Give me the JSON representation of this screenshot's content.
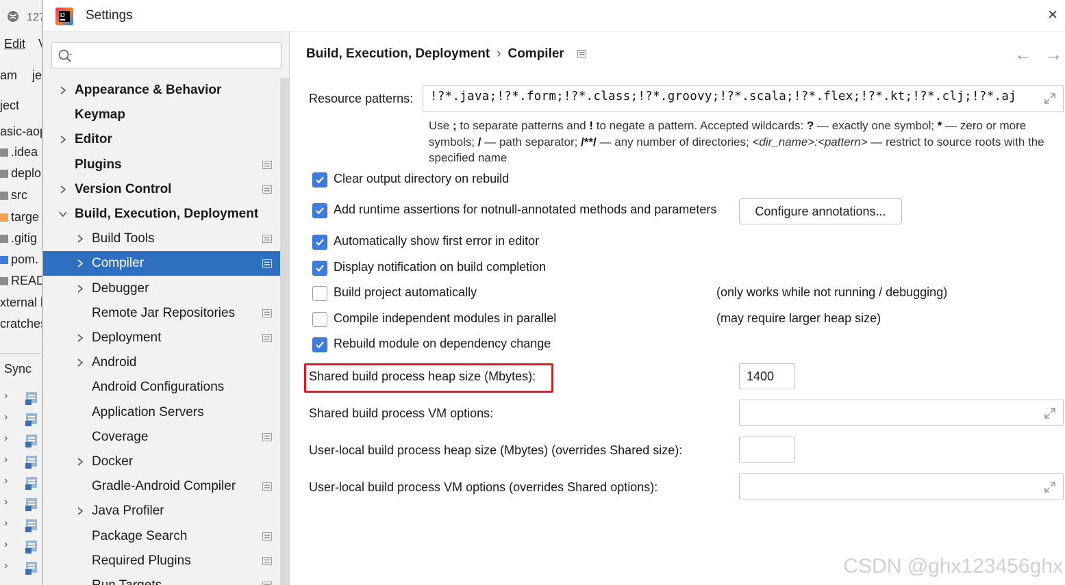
{
  "background_ide": {
    "tab_text": "127",
    "menu_edit": "Edit",
    "menu_next": "V",
    "breadcrumb_a": "am",
    "breadcrumb_b": "je",
    "project_label": "ject",
    "tree_root": "asic-aop",
    "tree_items": [
      ".idea",
      "deplo",
      "src",
      "targe",
      ".gitig",
      "pom.",
      "READ"
    ],
    "external": "xternal l",
    "scratches": "cratches",
    "sync": "Sync"
  },
  "dialog": {
    "title": "Settings",
    "close_symbol": "×"
  },
  "search": {
    "value": "",
    "placeholder": ""
  },
  "nav": {
    "items": [
      {
        "label": "Appearance & Behavior",
        "level": 0,
        "bold": true,
        "chevron": "right",
        "project_icon": false,
        "selected": false
      },
      {
        "label": "Keymap",
        "level": 0,
        "bold": true,
        "chevron": "none",
        "project_icon": false,
        "selected": false
      },
      {
        "label": "Editor",
        "level": 0,
        "bold": true,
        "chevron": "right",
        "project_icon": false,
        "selected": false
      },
      {
        "label": "Plugins",
        "level": 0,
        "bold": true,
        "chevron": "none",
        "project_icon": true,
        "selected": false
      },
      {
        "label": "Version Control",
        "level": 0,
        "bold": true,
        "chevron": "right",
        "project_icon": true,
        "selected": false
      },
      {
        "label": "Build, Execution, Deployment",
        "level": 0,
        "bold": true,
        "chevron": "down",
        "project_icon": false,
        "selected": false
      },
      {
        "label": "Build Tools",
        "level": 1,
        "bold": false,
        "chevron": "right",
        "project_icon": true,
        "selected": false
      },
      {
        "label": "Compiler",
        "level": 1,
        "bold": false,
        "chevron": "right",
        "project_icon": true,
        "selected": true
      },
      {
        "label": "Debugger",
        "level": 1,
        "bold": false,
        "chevron": "right",
        "project_icon": false,
        "selected": false
      },
      {
        "label": "Remote Jar Repositories",
        "level": 1,
        "bold": false,
        "chevron": "none",
        "project_icon": true,
        "selected": false
      },
      {
        "label": "Deployment",
        "level": 1,
        "bold": false,
        "chevron": "right",
        "project_icon": true,
        "selected": false
      },
      {
        "label": "Android",
        "level": 1,
        "bold": false,
        "chevron": "right",
        "project_icon": false,
        "selected": false
      },
      {
        "label": "Android Configurations",
        "level": 1,
        "bold": false,
        "chevron": "none",
        "project_icon": false,
        "selected": false
      },
      {
        "label": "Application Servers",
        "level": 1,
        "bold": false,
        "chevron": "none",
        "project_icon": false,
        "selected": false
      },
      {
        "label": "Coverage",
        "level": 1,
        "bold": false,
        "chevron": "none",
        "project_icon": true,
        "selected": false
      },
      {
        "label": "Docker",
        "level": 1,
        "bold": false,
        "chevron": "right",
        "project_icon": false,
        "selected": false
      },
      {
        "label": "Gradle-Android Compiler",
        "level": 1,
        "bold": false,
        "chevron": "none",
        "project_icon": true,
        "selected": false
      },
      {
        "label": "Java Profiler",
        "level": 1,
        "bold": false,
        "chevron": "right",
        "project_icon": false,
        "selected": false
      },
      {
        "label": "Package Search",
        "level": 1,
        "bold": false,
        "chevron": "none",
        "project_icon": true,
        "selected": false
      },
      {
        "label": "Required Plugins",
        "level": 1,
        "bold": false,
        "chevron": "none",
        "project_icon": true,
        "selected": false
      },
      {
        "label": "Run Targets",
        "level": 1,
        "bold": false,
        "chevron": "none",
        "project_icon": true,
        "selected": false
      }
    ]
  },
  "breadcrumb": {
    "parent": "Build, Execution, Deployment",
    "separator": "›",
    "current": "Compiler"
  },
  "nav_arrows": {
    "back": "←",
    "forward": "→"
  },
  "compiler": {
    "resource_patterns_label": "Resource patterns:",
    "resource_patterns_value": "!?*.java;!?*.form;!?*.class;!?*.groovy;!?*.scala;!?*.flex;!?*.kt;!?*.clj;!?*.aj",
    "hint": {
      "p1": "Use ",
      "b1": ";",
      "p2": " to separate patterns and ",
      "b2": "!",
      "p3": " to negate a pattern. Accepted wildcards: ",
      "b3": "?",
      "p4": " — exactly one symbol; ",
      "b4": "*",
      "p5": " — zero or more symbols; ",
      "b5": "/",
      "p6": " — path separator; ",
      "b6": "/**/",
      "p7": " — any number of directories; ",
      "i1": "<dir_name>:<pattern>",
      "p8": " — restrict to source roots with the specified name"
    },
    "checkboxes": [
      {
        "label": "Clear output directory on rebuild",
        "checked": true,
        "note": ""
      },
      {
        "label": "Add runtime assertions for notnull-annotated methods and parameters",
        "checked": true,
        "note": ""
      },
      {
        "label": "Automatically show first error in editor",
        "checked": true,
        "note": ""
      },
      {
        "label": "Display notification on build completion",
        "checked": true,
        "note": ""
      },
      {
        "label": "Build project automatically",
        "checked": false,
        "note": "(only works while not running / debugging)"
      },
      {
        "label": "Compile independent modules in parallel",
        "checked": false,
        "note": "(may require larger heap size)"
      },
      {
        "label": "Rebuild module on dependency change",
        "checked": true,
        "note": ""
      }
    ],
    "configure_button": "Configure annotations...",
    "shared_heap_label": "Shared build process heap size (Mbytes):",
    "shared_heap_value": "1400",
    "shared_vm_label": "Shared build process VM options:",
    "shared_vm_value": "",
    "user_heap_label": "User-local build process heap size (Mbytes) (overrides Shared size):",
    "user_heap_value": "",
    "user_vm_label": "User-local build process VM options (overrides Shared options):",
    "user_vm_value": ""
  },
  "colors": {
    "selection": "#2f6fc0",
    "checkbox_on": "#3d7bdc",
    "highlight_border": "#e0191c"
  },
  "watermark": "CSDN @ghx123456ghx"
}
